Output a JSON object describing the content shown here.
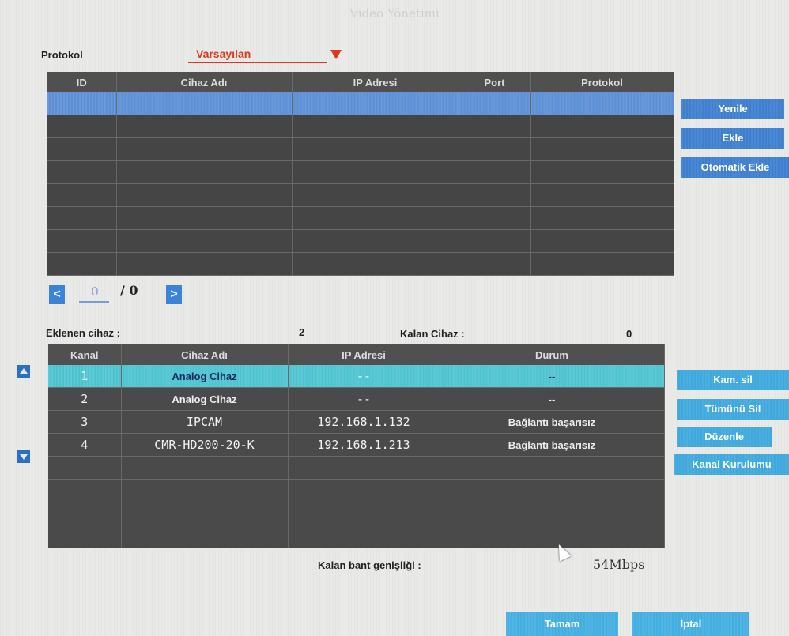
{
  "window": {
    "title": "Video Yönetimi"
  },
  "protocol": {
    "label": "Protokol",
    "selected": "Varsayılan"
  },
  "search_table": {
    "headers": [
      "ID",
      "Cihaz Adı",
      "IP Adresi",
      "Port",
      "Protokol"
    ],
    "row_count": 8,
    "selected_row": 0
  },
  "side_buttons_top": {
    "refresh": "Yenile",
    "add": "Ekle",
    "auto_add": "Otomatik Ekle"
  },
  "pager": {
    "prev": "<",
    "current": "0",
    "total": "/ 0",
    "next": ">"
  },
  "summary": {
    "added_label": "Eklenen cihaz :",
    "added_value": "2",
    "remaining_label": "Kalan Cihaz :",
    "remaining_value": "0"
  },
  "channel_table": {
    "headers": [
      "Kanal",
      "Cihaz Adı",
      "IP Adresi",
      "Durum"
    ],
    "rows": [
      {
        "channel": "1",
        "name": "Analog Cihaz",
        "ip": "--",
        "status": "--"
      },
      {
        "channel": "2",
        "name": "Analog Cihaz",
        "ip": "--",
        "status": "--"
      },
      {
        "channel": "3",
        "name": "IPCAM",
        "ip": "192.168.1.132",
        "status": "Bağlantı başarısız"
      },
      {
        "channel": "4",
        "name": "CMR-HD200-20-K",
        "ip": "192.168.1.213",
        "status": "Bağlantı başarısız"
      }
    ],
    "selected_row": 0
  },
  "side_buttons_bottom": {
    "delete_cam": "Kam. sil",
    "delete_all": "Tümünü Sil",
    "edit": "Düzenle",
    "channel_setup": "Kanal Kurulumu"
  },
  "bandwidth": {
    "label": "Kalan bant genişliği :",
    "value": "54Mbps"
  },
  "footer": {
    "ok": "Tamam",
    "cancel": "İptal"
  },
  "colors": {
    "accent_blue": "#3f7fcf",
    "selection_cyan": "#4cc3cf",
    "protocol_red": "#e0361b"
  }
}
